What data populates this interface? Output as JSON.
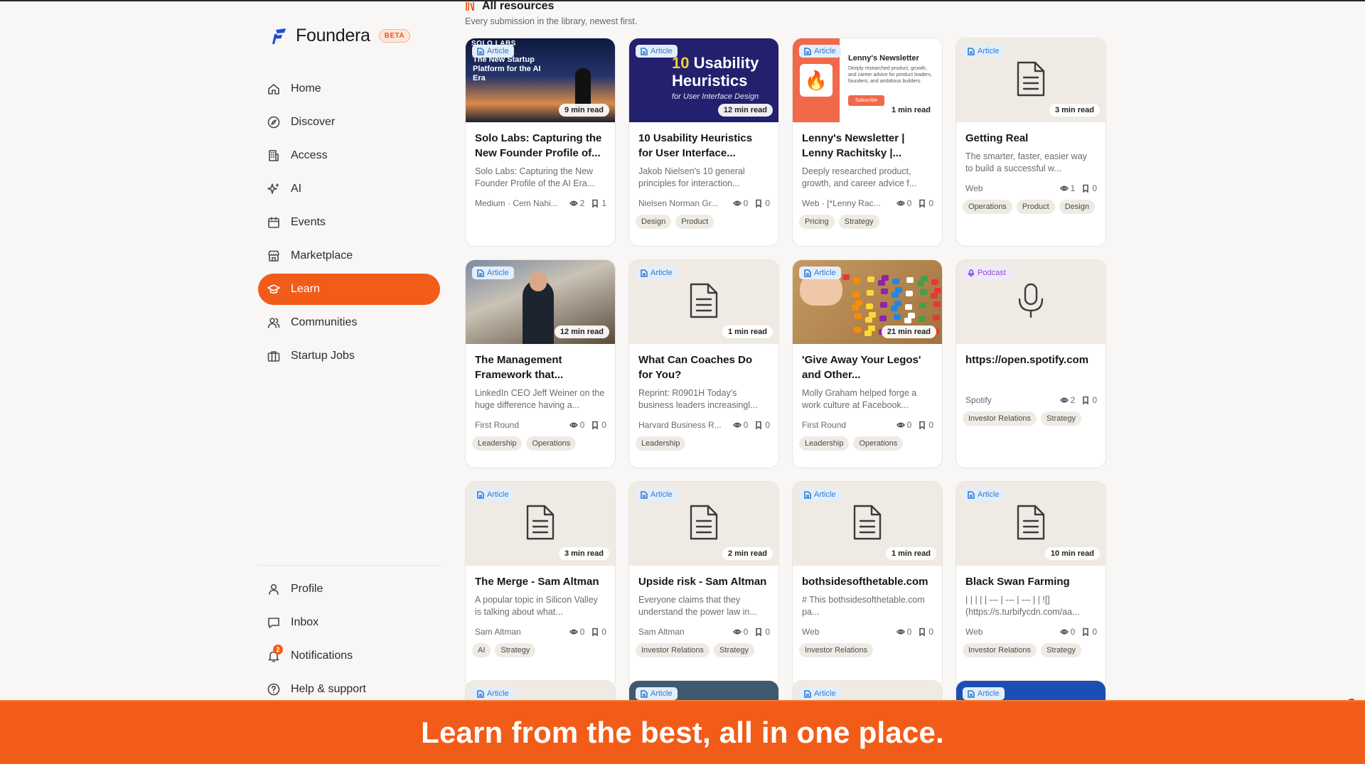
{
  "brand": {
    "name": "Foundera",
    "badge": "BETA"
  },
  "nav": {
    "main": [
      {
        "label": "Home",
        "icon": "home-icon",
        "active": false
      },
      {
        "label": "Discover",
        "icon": "compass-icon",
        "active": false
      },
      {
        "label": "Access",
        "icon": "building-icon",
        "active": false
      },
      {
        "label": "AI",
        "icon": "sparkles-icon",
        "active": false
      },
      {
        "label": "Events",
        "icon": "calendar-icon",
        "active": false
      },
      {
        "label": "Marketplace",
        "icon": "store-icon",
        "active": false
      },
      {
        "label": "Learn",
        "icon": "graduation-cap-icon",
        "active": true
      },
      {
        "label": "Communities",
        "icon": "users-icon",
        "active": false
      },
      {
        "label": "Startup Jobs",
        "icon": "briefcase-icon",
        "active": false
      }
    ],
    "bottom": [
      {
        "label": "Profile",
        "icon": "user-icon"
      },
      {
        "label": "Inbox",
        "icon": "inbox-icon"
      },
      {
        "label": "Notifications",
        "icon": "bell-icon",
        "badge": "2"
      },
      {
        "label": "Help & support",
        "icon": "help-circle-icon"
      }
    ]
  },
  "main": {
    "title": "All resources",
    "subtitle": "Every submission in the library, newest first.",
    "cards": [
      {
        "type": "Article",
        "read": "9 min read",
        "title": "Solo Labs: Capturing the New Founder Profile of...",
        "desc": "Solo Labs: Capturing the New Founder Profile of the AI Era...",
        "source": "Medium · Cem Nahi...",
        "views": "2",
        "saves": "1",
        "tags": [],
        "thumb": "solo",
        "thumb_text": {
          "brand": "SOLO LABS",
          "headline": "The New Startup Platform for the AI Era"
        }
      },
      {
        "type": "Article",
        "read": "12 min read",
        "title": "10 Usability Heuristics for User Interface...",
        "desc": "Jakob Nielsen's 10 general principles for interaction...",
        "source": "Nielsen Norman Gr...",
        "views": "0",
        "saves": "0",
        "tags": [
          "Design",
          "Product"
        ],
        "thumb": "nng",
        "thumb_text": {
          "number": "10",
          "headline": "Usability Heuristics",
          "sub": "for User Interface Design"
        }
      },
      {
        "type": "Article",
        "read": "1 min read",
        "title": "Lenny's Newsletter | Lenny Rachitsky |...",
        "desc": "Deeply researched product, growth, and career advice f...",
        "source": "Web · [*Lenny Rac...",
        "views": "0",
        "saves": "0",
        "tags": [
          "Pricing",
          "Strategy"
        ],
        "thumb": "lenny",
        "thumb_text": {
          "name": "Lenny's Newsletter",
          "desc": "Deeply researched product, growth, and career advice for product leaders, founders, and ambitious builders.",
          "button": "Subscribe"
        }
      },
      {
        "type": "Article",
        "read": "3 min read",
        "title": "Getting Real",
        "desc": "The smarter, faster, easier way to build a successful w...",
        "source": "Web",
        "views": "1",
        "saves": "0",
        "tags": [
          "Operations",
          "Product",
          "Design"
        ],
        "thumb": "doc"
      },
      {
        "type": "Article",
        "read": "12 min read",
        "title": "The Management Framework that...",
        "desc": "LinkedIn CEO Jeff Weiner on the huge difference having a...",
        "source": "First Round",
        "views": "0",
        "saves": "0",
        "tags": [
          "Leadership",
          "Operations"
        ],
        "thumb": "mgmt"
      },
      {
        "type": "Article",
        "read": "1 min read",
        "title": "What Can Coaches Do for You?",
        "desc": "Reprint: R0901H Today's business leaders increasingl...",
        "source": "Harvard Business R...",
        "views": "0",
        "saves": "0",
        "tags": [
          "Leadership"
        ],
        "thumb": "doc"
      },
      {
        "type": "Article",
        "read": "21 min read",
        "title": "'Give Away Your Legos' and Other...",
        "desc": "Molly Graham helped forge a work culture at Facebook...",
        "source": "First Round",
        "views": "0",
        "saves": "0",
        "tags": [
          "Leadership",
          "Operations"
        ],
        "thumb": "lego"
      },
      {
        "type": "Podcast",
        "read": "",
        "title": "https://open.spotify.com",
        "desc": "",
        "source": "Spotify",
        "views": "2",
        "saves": "0",
        "tags": [
          "Investor Relations",
          "Strategy"
        ],
        "thumb": "mic"
      },
      {
        "type": "Article",
        "read": "3 min read",
        "title": "The Merge - Sam Altman",
        "desc": "A popular topic in Silicon Valley is talking about what...",
        "source": "Sam Altman",
        "views": "0",
        "saves": "0",
        "tags": [
          "AI",
          "Strategy"
        ],
        "thumb": "doc"
      },
      {
        "type": "Article",
        "read": "2 min read",
        "title": "Upside risk - Sam Altman",
        "desc": "Everyone claims that they understand the power law in...",
        "source": "Sam Altman",
        "views": "0",
        "saves": "0",
        "tags": [
          "Investor Relations",
          "Strategy"
        ],
        "thumb": "doc"
      },
      {
        "type": "Article",
        "read": "1 min read",
        "title": "bothsidesofthetable.com",
        "desc": "# This bothsidesofthetable.com pa...",
        "source": "Web",
        "views": "0",
        "saves": "0",
        "tags": [
          "Investor Relations"
        ],
        "thumb": "doc"
      },
      {
        "type": "Article",
        "read": "10 min read",
        "title": "Black Swan Farming",
        "desc": "| | | | | --- | --- | --- | | ![](https://s.turbifycdn.com/aa...",
        "source": "Web",
        "views": "0",
        "saves": "0",
        "tags": [
          "Investor Relations",
          "Strategy"
        ],
        "thumb": "doc"
      }
    ],
    "peek": [
      {
        "type": "Article",
        "style": "light"
      },
      {
        "type": "Article",
        "style": "dark"
      },
      {
        "type": "Article",
        "style": "light"
      },
      {
        "type": "Article",
        "style": "blue"
      }
    ]
  },
  "banner": {
    "text": "Learn from the best, all in one place."
  },
  "colors": {
    "accent": "#f25c19",
    "article_chip": "#2e7bd1",
    "podcast_chip": "#8a4ed1"
  }
}
